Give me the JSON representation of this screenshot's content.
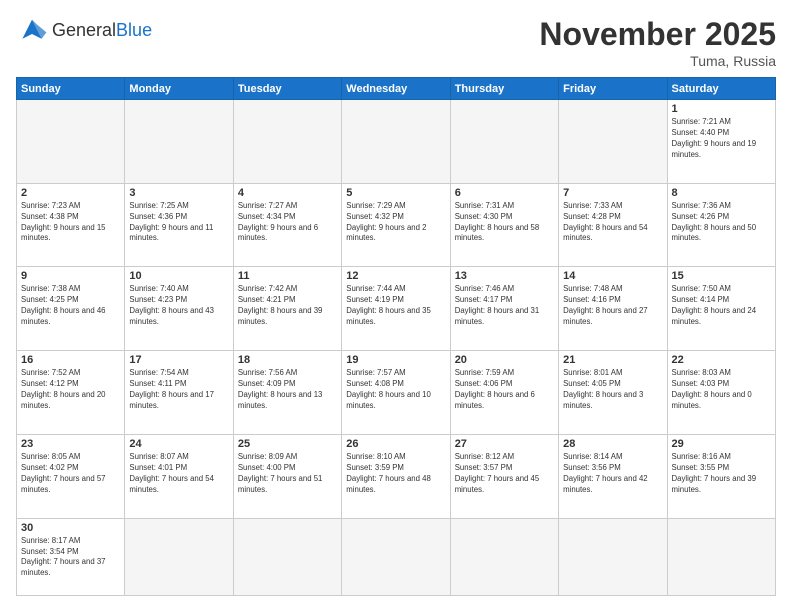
{
  "header": {
    "logo_general": "General",
    "logo_blue": "Blue",
    "month_title": "November 2025",
    "location": "Tuma, Russia"
  },
  "weekdays": [
    "Sunday",
    "Monday",
    "Tuesday",
    "Wednesday",
    "Thursday",
    "Friday",
    "Saturday"
  ],
  "weeks": [
    [
      {
        "day": "",
        "empty": true
      },
      {
        "day": "",
        "empty": true
      },
      {
        "day": "",
        "empty": true
      },
      {
        "day": "",
        "empty": true
      },
      {
        "day": "",
        "empty": true
      },
      {
        "day": "",
        "empty": true
      },
      {
        "day": "1",
        "sunrise": "7:21 AM",
        "sunset": "4:40 PM",
        "daylight": "9 hours and 19 minutes."
      }
    ],
    [
      {
        "day": "2",
        "sunrise": "7:23 AM",
        "sunset": "4:38 PM",
        "daylight": "9 hours and 15 minutes."
      },
      {
        "day": "3",
        "sunrise": "7:25 AM",
        "sunset": "4:36 PM",
        "daylight": "9 hours and 11 minutes."
      },
      {
        "day": "4",
        "sunrise": "7:27 AM",
        "sunset": "4:34 PM",
        "daylight": "9 hours and 6 minutes."
      },
      {
        "day": "5",
        "sunrise": "7:29 AM",
        "sunset": "4:32 PM",
        "daylight": "9 hours and 2 minutes."
      },
      {
        "day": "6",
        "sunrise": "7:31 AM",
        "sunset": "4:30 PM",
        "daylight": "8 hours and 58 minutes."
      },
      {
        "day": "7",
        "sunrise": "7:33 AM",
        "sunset": "4:28 PM",
        "daylight": "8 hours and 54 minutes."
      },
      {
        "day": "8",
        "sunrise": "7:36 AM",
        "sunset": "4:26 PM",
        "daylight": "8 hours and 50 minutes."
      }
    ],
    [
      {
        "day": "9",
        "sunrise": "7:38 AM",
        "sunset": "4:25 PM",
        "daylight": "8 hours and 46 minutes."
      },
      {
        "day": "10",
        "sunrise": "7:40 AM",
        "sunset": "4:23 PM",
        "daylight": "8 hours and 43 minutes."
      },
      {
        "day": "11",
        "sunrise": "7:42 AM",
        "sunset": "4:21 PM",
        "daylight": "8 hours and 39 minutes."
      },
      {
        "day": "12",
        "sunrise": "7:44 AM",
        "sunset": "4:19 PM",
        "daylight": "8 hours and 35 minutes."
      },
      {
        "day": "13",
        "sunrise": "7:46 AM",
        "sunset": "4:17 PM",
        "daylight": "8 hours and 31 minutes."
      },
      {
        "day": "14",
        "sunrise": "7:48 AM",
        "sunset": "4:16 PM",
        "daylight": "8 hours and 27 minutes."
      },
      {
        "day": "15",
        "sunrise": "7:50 AM",
        "sunset": "4:14 PM",
        "daylight": "8 hours and 24 minutes."
      }
    ],
    [
      {
        "day": "16",
        "sunrise": "7:52 AM",
        "sunset": "4:12 PM",
        "daylight": "8 hours and 20 minutes."
      },
      {
        "day": "17",
        "sunrise": "7:54 AM",
        "sunset": "4:11 PM",
        "daylight": "8 hours and 17 minutes."
      },
      {
        "day": "18",
        "sunrise": "7:56 AM",
        "sunset": "4:09 PM",
        "daylight": "8 hours and 13 minutes."
      },
      {
        "day": "19",
        "sunrise": "7:57 AM",
        "sunset": "4:08 PM",
        "daylight": "8 hours and 10 minutes."
      },
      {
        "day": "20",
        "sunrise": "7:59 AM",
        "sunset": "4:06 PM",
        "daylight": "8 hours and 6 minutes."
      },
      {
        "day": "21",
        "sunrise": "8:01 AM",
        "sunset": "4:05 PM",
        "daylight": "8 hours and 3 minutes."
      },
      {
        "day": "22",
        "sunrise": "8:03 AM",
        "sunset": "4:03 PM",
        "daylight": "8 hours and 0 minutes."
      }
    ],
    [
      {
        "day": "23",
        "sunrise": "8:05 AM",
        "sunset": "4:02 PM",
        "daylight": "7 hours and 57 minutes."
      },
      {
        "day": "24",
        "sunrise": "8:07 AM",
        "sunset": "4:01 PM",
        "daylight": "7 hours and 54 minutes."
      },
      {
        "day": "25",
        "sunrise": "8:09 AM",
        "sunset": "4:00 PM",
        "daylight": "7 hours and 51 minutes."
      },
      {
        "day": "26",
        "sunrise": "8:10 AM",
        "sunset": "3:59 PM",
        "daylight": "7 hours and 48 minutes."
      },
      {
        "day": "27",
        "sunrise": "8:12 AM",
        "sunset": "3:57 PM",
        "daylight": "7 hours and 45 minutes."
      },
      {
        "day": "28",
        "sunrise": "8:14 AM",
        "sunset": "3:56 PM",
        "daylight": "7 hours and 42 minutes."
      },
      {
        "day": "29",
        "sunrise": "8:16 AM",
        "sunset": "3:55 PM",
        "daylight": "7 hours and 39 minutes."
      }
    ],
    [
      {
        "day": "30",
        "sunrise": "8:17 AM",
        "sunset": "3:54 PM",
        "daylight": "7 hours and 37 minutes."
      },
      {
        "day": "",
        "empty": true
      },
      {
        "day": "",
        "empty": true
      },
      {
        "day": "",
        "empty": true
      },
      {
        "day": "",
        "empty": true
      },
      {
        "day": "",
        "empty": true
      },
      {
        "day": "",
        "empty": true
      }
    ]
  ]
}
